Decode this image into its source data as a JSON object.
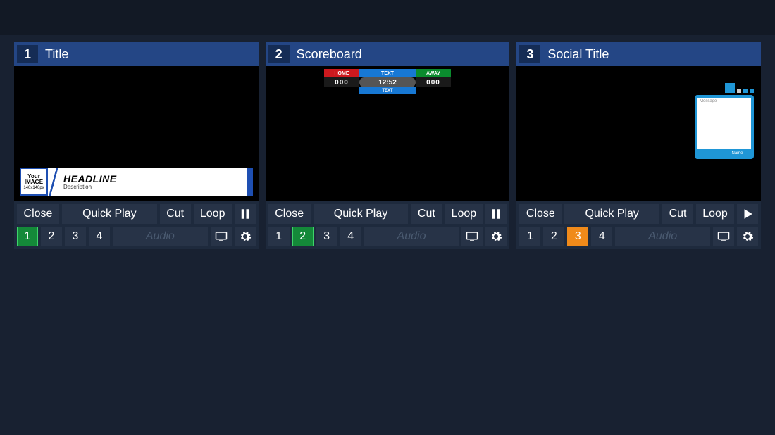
{
  "buttons": {
    "close": "Close",
    "quick_play": "Quick Play",
    "cut": "Cut",
    "loop": "Loop",
    "n1": "1",
    "n2": "2",
    "n3": "3",
    "n4": "4",
    "audio": "Audio"
  },
  "panels": [
    {
      "num": "1",
      "title": "Title",
      "active_preset": 1,
      "playing": true,
      "lower_third": {
        "img_text_1": "Your",
        "img_text_2": "IMAGE",
        "img_text_3": "140x140px",
        "headline": "HEADLINE",
        "description": "Description"
      }
    },
    {
      "num": "2",
      "title": "Scoreboard",
      "active_preset": 2,
      "playing": true,
      "scoreboard": {
        "home": "HOME",
        "away": "AWAY",
        "text_top": "TEXT",
        "text_bottom": "TEXT",
        "score_home": "000",
        "score_away": "000",
        "clock": "12:52"
      }
    },
    {
      "num": "3",
      "title": "Social Title",
      "active_preset": 3,
      "playing": false,
      "social": {
        "message": "Message",
        "name": "Name"
      }
    }
  ]
}
